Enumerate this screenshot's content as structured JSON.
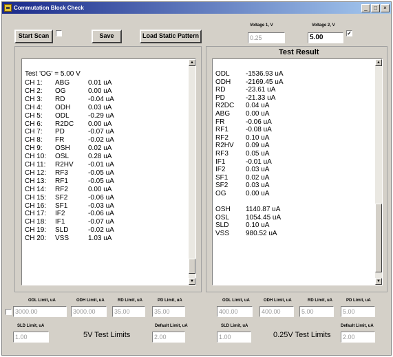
{
  "window": {
    "title": "Commutation Block Check",
    "min_glyph": "_",
    "max_glyph": "□",
    "close_glyph": "×"
  },
  "toolbar": {
    "start_scan_label": "Start Scan",
    "save_label": "Save",
    "load_static_label": "Load Static Pattern",
    "voltage1_label": "Voltage 1, V",
    "voltage1_value": "0.25",
    "voltage2_label": "Voltage 2, V",
    "voltage2_value": "5.00",
    "voltage2_checked": "✓"
  },
  "left_panel": {
    "header": "Test 'OG' = 5.00 V",
    "rows": [
      {
        "ch": "CH 1:",
        "name": "ABG",
        "value": "0.01 uA"
      },
      {
        "ch": "CH 2:",
        "name": "OG",
        "value": "0.00 uA"
      },
      {
        "ch": "CH 3:",
        "name": "RD",
        "value": "-0.04 uA"
      },
      {
        "ch": "CH 4:",
        "name": "ODH",
        "value": "0.03 uA"
      },
      {
        "ch": "CH 5:",
        "name": "ODL",
        "value": "-0.29 uA"
      },
      {
        "ch": "CH 6:",
        "name": "R2DC",
        "value": "0.00 uA"
      },
      {
        "ch": "CH 7:",
        "name": "PD",
        "value": "-0.07 uA"
      },
      {
        "ch": "CH 8:",
        "name": "FR",
        "value": "-0.02 uA"
      },
      {
        "ch": "CH 9:",
        "name": "OSH",
        "value": "0.02 uA"
      },
      {
        "ch": "CH 10:",
        "name": "OSL",
        "value": "0.28 uA"
      },
      {
        "ch": "CH 11:",
        "name": "R2HV",
        "value": "-0.01 uA"
      },
      {
        "ch": "CH 12:",
        "name": "RF3",
        "value": "-0.05 uA"
      },
      {
        "ch": "CH 13:",
        "name": "RF1",
        "value": "-0.05 uA"
      },
      {
        "ch": "CH 14:",
        "name": "RF2",
        "value": "0.00 uA"
      },
      {
        "ch": "CH 15:",
        "name": "SF2",
        "value": "-0.06 uA"
      },
      {
        "ch": "CH 16:",
        "name": "SF1",
        "value": "-0.03 uA"
      },
      {
        "ch": "CH 17:",
        "name": "IF2",
        "value": "-0.06 uA"
      },
      {
        "ch": "CH 18:",
        "name": "IF1",
        "value": "-0.07 uA"
      },
      {
        "ch": "CH 19:",
        "name": "SLD",
        "value": "-0.02 uA"
      },
      {
        "ch": "CH 20:",
        "name": "VSS",
        "value": "1.03 uA"
      }
    ]
  },
  "right_panel": {
    "title": "Test Result",
    "rows": [
      {
        "name": "ODL",
        "value": "-1536.93 uA"
      },
      {
        "name": "ODH",
        "value": "-2169.45 uA"
      },
      {
        "name": "RD",
        "value": "-23.61 uA"
      },
      {
        "name": "PD",
        "value": "-21.33 uA"
      },
      {
        "name": "R2DC",
        "value": "0.04 uA"
      },
      {
        "name": "ABG",
        "value": "0.00 uA"
      },
      {
        "name": "FR",
        "value": "-0.06 uA"
      },
      {
        "name": "RF1",
        "value": "-0.08 uA"
      },
      {
        "name": "RF2",
        "value": "0.10 uA"
      },
      {
        "name": "R2HV",
        "value": "0.09 uA"
      },
      {
        "name": "RF3",
        "value": "0.05 uA"
      },
      {
        "name": "IF1",
        "value": "-0.01 uA"
      },
      {
        "name": "IF2",
        "value": "0.03 uA"
      },
      {
        "name": "SF1",
        "value": "0.02 uA"
      },
      {
        "name": "SF2",
        "value": "0.03 uA"
      },
      {
        "name": "OG",
        "value": "0.00 uA"
      },
      {
        "name": "",
        "value": ""
      },
      {
        "name": "OSH",
        "value": "1140.87 uA"
      },
      {
        "name": "OSL",
        "value": "1054.45 uA"
      },
      {
        "name": "SLD",
        "value": "0.10 uA"
      },
      {
        "name": "VSS",
        "value": "980.52 uA"
      }
    ]
  },
  "limits_5v": {
    "title": "5V Test Limits",
    "odl_label": "ODL Limit, uA",
    "odl_value": "3000.00",
    "odh_label": "ODH Limit, uA",
    "odh_value": "3000.00",
    "rd_label": "RD Limit, uA",
    "rd_value": "35.00",
    "pd_label": "PD Limit, uA",
    "pd_value": "35.00",
    "sld_label": "SLD Limit, uA",
    "sld_value": "1.00",
    "default_label": "Default Limit, uA",
    "default_value": "2.00"
  },
  "limits_025v": {
    "title": "0.25V Test Limits",
    "odl_label": "ODL Limit, uA",
    "odl_value": "400.00",
    "odh_label": "ODH Limit, uA",
    "odh_value": "400.00",
    "rd_label": "RD Limit, uA",
    "rd_value": "5.00",
    "pd_label": "PD Limit, uA",
    "pd_value": "5.00",
    "sld_label": "SLD Limit, uA",
    "sld_value": "1.00",
    "default_label": "Default Limit, uA",
    "default_value": "2.00"
  },
  "scroll": {
    "up": "▲",
    "down": "▼"
  }
}
